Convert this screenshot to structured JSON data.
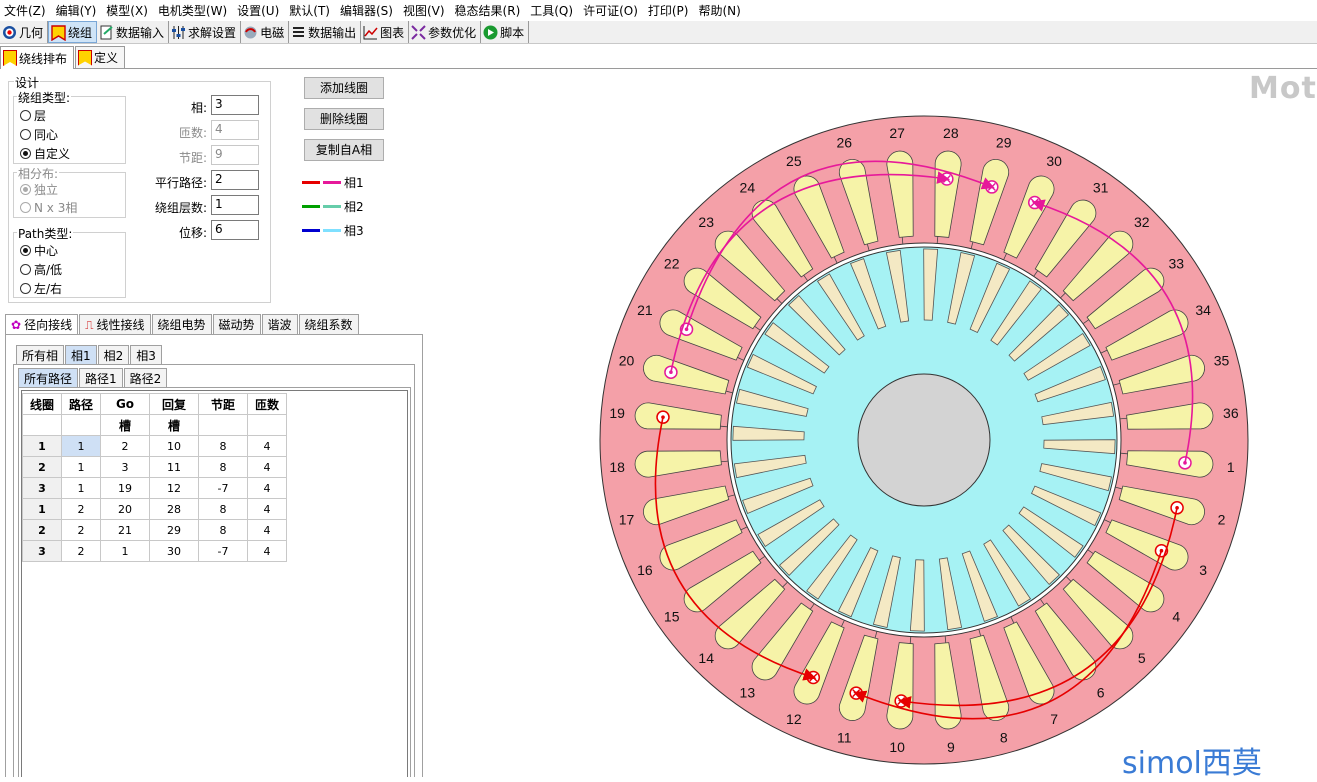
{
  "menu": [
    "文件(Z)",
    "编辑(Y)",
    "模型(X)",
    "电机类型(W)",
    "设置(U)",
    "默认(T)",
    "编辑器(S)",
    "视图(V)",
    "稳态结果(R)",
    "工具(Q)",
    "许可证(O)",
    "打印(P)",
    "帮助(N)"
  ],
  "toolbar": [
    {
      "label": "几何",
      "icon": "target-icon"
    },
    {
      "label": "绕组",
      "icon": "bookmark-icon",
      "active": true
    },
    {
      "label": "数据输入",
      "icon": "data-input-icon"
    },
    {
      "label": "求解设置",
      "icon": "sliders-icon"
    },
    {
      "label": "电磁",
      "icon": "magnet-icon"
    },
    {
      "label": "数据输出",
      "icon": "list-icon"
    },
    {
      "label": "图表",
      "icon": "chart-icon"
    },
    {
      "label": "参数优化",
      "icon": "optimize-icon"
    },
    {
      "label": "脚本",
      "icon": "play-icon"
    }
  ],
  "subtabs": [
    "绕线排布",
    "定义"
  ],
  "design": {
    "title": "设计",
    "winding_type": {
      "label": "绕组类型:",
      "options": [
        "层",
        "同心",
        "自定义"
      ],
      "selected": 2
    },
    "phase_dist": {
      "label": "相分布:",
      "options": [
        "独立",
        "N x 3相"
      ],
      "selected": 0
    },
    "path_type": {
      "label": "Path类型:",
      "options": [
        "中心",
        "高/低",
        "左/右"
      ],
      "selected": 0
    },
    "fields": [
      {
        "label": "相:",
        "value": "3",
        "disabled": false
      },
      {
        "label": "匝数:",
        "value": "4",
        "disabled": true
      },
      {
        "label": "节距:",
        "value": "9",
        "disabled": true
      },
      {
        "label": "平行路径:",
        "value": "2",
        "disabled": false
      },
      {
        "label": "绕组层数:",
        "value": "1",
        "disabled": false
      },
      {
        "label": "位移:",
        "value": "6",
        "disabled": false
      }
    ]
  },
  "buttons": [
    "添加线圈",
    "删除线圈",
    "复制自A相"
  ],
  "legend": [
    {
      "label": "相1",
      "c1": "#e60000",
      "c2": "#e6199a"
    },
    {
      "label": "相2",
      "c1": "#00a000",
      "c2": "#66cdaa"
    },
    {
      "label": "相3",
      "c1": "#0000d0",
      "c2": "#7fe0ff"
    }
  ],
  "bottom_tabs": [
    "径向接线",
    "线性接线",
    "绕组电势",
    "磁动势",
    "谐波",
    "绕组系数"
  ],
  "phase_tabs": [
    "所有相",
    "相1",
    "相2",
    "相3"
  ],
  "path_tabs": [
    "所有路径",
    "路径1",
    "路径2"
  ],
  "table": {
    "headers": [
      "线圈",
      "路径",
      "Go",
      "回复",
      "节距",
      "匝数"
    ],
    "subheaders": [
      "",
      "",
      "槽",
      "槽",
      "",
      ""
    ],
    "rows": [
      [
        "1",
        "1",
        "2",
        "10",
        "8",
        "4"
      ],
      [
        "2",
        "1",
        "3",
        "11",
        "8",
        "4"
      ],
      [
        "3",
        "1",
        "19",
        "12",
        "-7",
        "4"
      ],
      [
        "1",
        "2",
        "20",
        "28",
        "8",
        "4"
      ],
      [
        "2",
        "2",
        "21",
        "29",
        "8",
        "4"
      ],
      [
        "3",
        "2",
        "1",
        "30",
        "-7",
        "4"
      ]
    ]
  },
  "slot_labels": [
    "1",
    "2",
    "3",
    "4",
    "5",
    "6",
    "7",
    "8",
    "9",
    "10",
    "11",
    "12",
    "13",
    "14",
    "15",
    "16",
    "17",
    "18",
    "19",
    "20",
    "21",
    "22",
    "23",
    "24",
    "25",
    "26",
    "27",
    "28",
    "29",
    "30",
    "31",
    "32",
    "33",
    "34",
    "35",
    "36"
  ],
  "watermark_top": "Moto",
  "watermark_logo": "simol西莫",
  "colors": {
    "stator": "#f4a0a8",
    "slot": "#f6f3a8",
    "rotor": "#a6f2f4",
    "rotor_slot": "#f4e9c4",
    "shaft": "#d3d3d3",
    "phase1_go": "#e60000",
    "phase1_ret": "#e6199a"
  }
}
